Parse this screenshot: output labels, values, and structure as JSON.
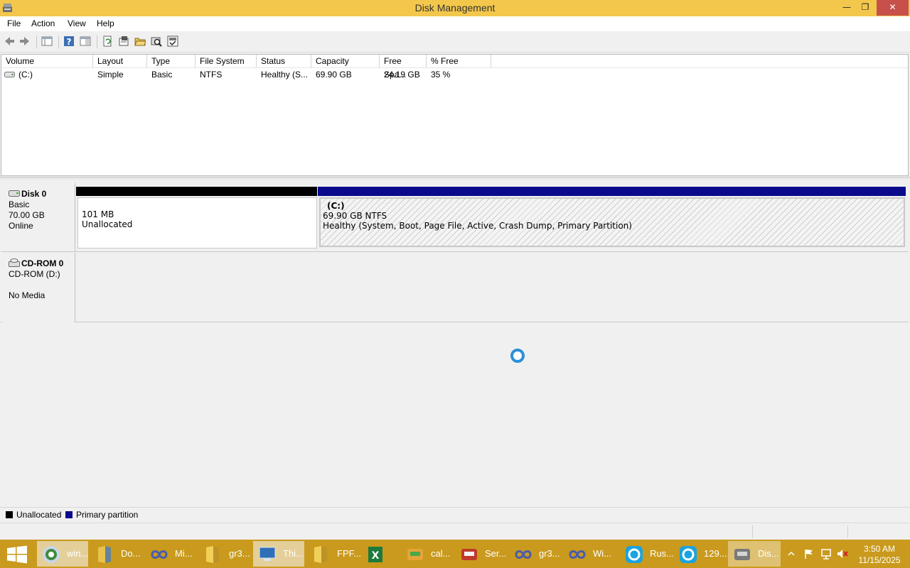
{
  "window": {
    "title": "Disk Management"
  },
  "menu": [
    "File",
    "Action",
    "View",
    "Help"
  ],
  "toolbar": {
    "icons": [
      "back-arrow-icon",
      "forward-arrow-icon",
      "console-tree-icon",
      "help-icon",
      "show-hide-icon",
      "refresh-icon",
      "properties-icon",
      "open-folder-icon",
      "explore-icon",
      "disk-check-icon"
    ]
  },
  "volume_list": {
    "columns": [
      "Volume",
      "Layout",
      "Type",
      "File System",
      "Status",
      "Capacity",
      "Free Spa...",
      "% Free"
    ],
    "rows": [
      {
        "volume": "(C:)",
        "layout": "Simple",
        "type": "Basic",
        "fs": "NTFS",
        "status": "Healthy (S...",
        "capacity": "69.90 GB",
        "free": "24.19 GB",
        "pct": "35 %"
      }
    ]
  },
  "disks": [
    {
      "name": "Disk 0",
      "type": "Basic",
      "size": "70.00 GB",
      "state": "Online",
      "partitions": [
        {
          "line1": "101 MB",
          "line2": "Unallocated"
        },
        {
          "line1": "(C:)",
          "line2": "69.90 GB NTFS",
          "line3": "Healthy (System, Boot, Page File, Active, Crash Dump, Primary Partition)"
        }
      ]
    },
    {
      "name": "CD-ROM 0",
      "type": "CD-ROM (D:)",
      "state": "No Media"
    }
  ],
  "legend": [
    {
      "label": "Unallocated",
      "color": "#000000"
    },
    {
      "label": "Primary partition",
      "color": "#0a0a8c"
    }
  ],
  "taskbar": {
    "items": [
      {
        "label": "win...",
        "icon": "browser-globe-icon"
      },
      {
        "label": "Do...",
        "icon": "downloads-folder-icon"
      },
      {
        "label": "Mi...",
        "icon": "infinity-app-icon"
      },
      {
        "label": "gr3...",
        "icon": "folder-icon"
      },
      {
        "label": "Thi...",
        "icon": "this-pc-icon"
      },
      {
        "label": "FPF...",
        "icon": "folder-icon"
      },
      {
        "label": "",
        "icon": "excel-icon"
      },
      {
        "label": "cal...",
        "icon": "calculator-app-icon"
      },
      {
        "label": "Ser...",
        "icon": "server-app-icon"
      },
      {
        "label": "gr3...",
        "icon": "infinity-app-icon"
      },
      {
        "label": "Wi...",
        "icon": "infinity-app-icon"
      },
      {
        "label": "Rus...",
        "icon": "sync-app-icon"
      },
      {
        "label": "129...",
        "icon": "sync-app-icon"
      },
      {
        "label": "Dis...",
        "icon": "disk-management-icon"
      }
    ],
    "clock": {
      "time": "3:50 AM",
      "date": "11/15/2025"
    }
  }
}
